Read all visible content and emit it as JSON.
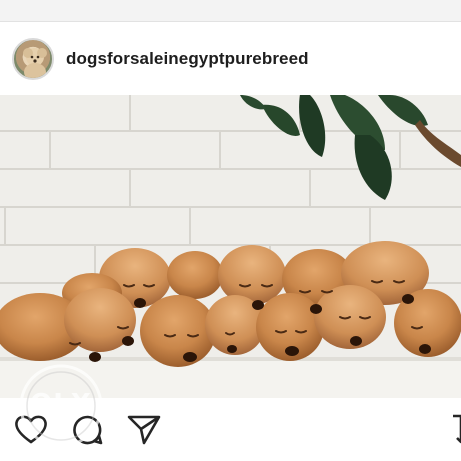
{
  "post": {
    "username": "dogsforsaleinegyptpurebreed",
    "watermark_text": "OLX"
  },
  "icons": {
    "avatar": "poodle-avatar",
    "like": "heart-icon",
    "comment": "comment-bubble-icon",
    "share": "paper-plane-icon",
    "save": "bookmark-icon"
  },
  "colors": {
    "puppy_fur": "#c9864a",
    "wall": "#efeeea",
    "leaf": "#1f3a24"
  }
}
